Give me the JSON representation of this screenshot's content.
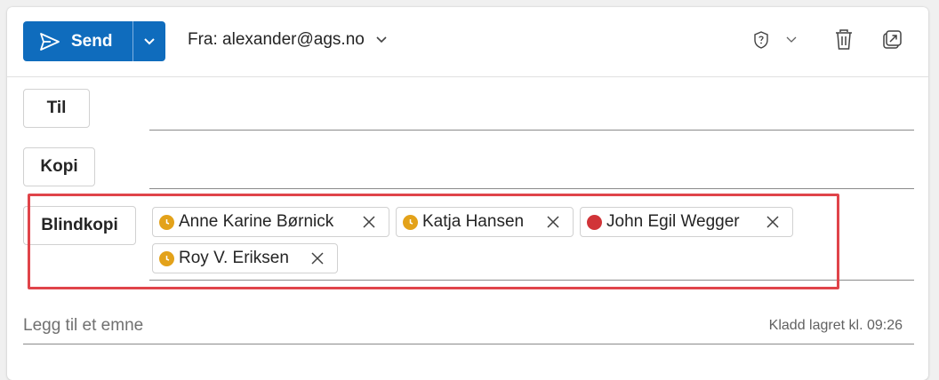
{
  "toolbar": {
    "send_label": "Send",
    "send_icon": "send-icon",
    "send_dropdown_icon": "chevron-down-icon",
    "from_label": "Fra: alexander@ags.no",
    "sensitivity_icon": "shield-question-icon",
    "discard_icon": "trash-icon",
    "popout_icon": "pop-out-icon"
  },
  "fields": {
    "to_label": "Til",
    "cc_label": "Kopi",
    "bcc_label": "Blindkopi"
  },
  "bcc_recipients": [
    {
      "name": "Anne Karine Børnick",
      "status": "away",
      "status_color": "#e3a21a"
    },
    {
      "name": "Katja Hansen",
      "status": "away",
      "status_color": "#e3a21a"
    },
    {
      "name": "John Egil Wegger",
      "status": "busy",
      "status_color": "#d13438"
    },
    {
      "name": "Roy V. Eriksen",
      "status": "away",
      "status_color": "#e3a21a"
    }
  ],
  "subject": {
    "placeholder": "Legg til et emne",
    "draft_status": "Kladd lagret kl. 09:26"
  },
  "colors": {
    "accent": "#0f6cbd",
    "highlight": "#e0444a"
  }
}
